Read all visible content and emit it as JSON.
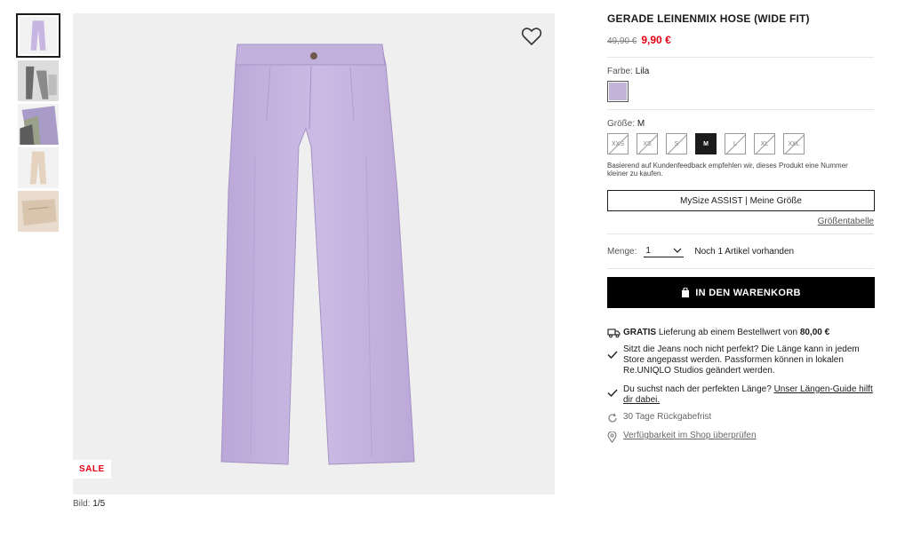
{
  "thumbnails": [
    {
      "name": "thumb-front-lilac",
      "active": true
    },
    {
      "name": "thumb-model-gray",
      "active": false
    },
    {
      "name": "thumb-colors-stack",
      "active": false
    },
    {
      "name": "thumb-beige",
      "active": false
    },
    {
      "name": "thumb-beige-detail",
      "active": false
    }
  ],
  "image": {
    "sale_label": "SALE",
    "caption_prefix": "Bild:",
    "caption_value": "1/5"
  },
  "product": {
    "title": "GERADE LEINENMIX HOSE (WIDE FIT)",
    "old_price": "49,90 €",
    "new_price": "9,90 €",
    "color_label": "Farbe:",
    "color_value": "Lila",
    "size_label": "Größe:",
    "size_value": "M",
    "sizes": [
      {
        "label": "XXS",
        "state": "unavailable"
      },
      {
        "label": "XS",
        "state": "unavailable"
      },
      {
        "label": "S",
        "state": "unavailable"
      },
      {
        "label": "M",
        "state": "selected"
      },
      {
        "label": "L",
        "state": "unavailable"
      },
      {
        "label": "XL",
        "state": "unavailable"
      },
      {
        "label": "XXL",
        "state": "unavailable"
      }
    ],
    "size_note": "Basierend auf Kundenfeedback empfehlen wir, dieses Produkt eine Nummer kleiner zu kaufen.",
    "mysize_button": "MySize ASSIST | Meine Größe",
    "size_table_link": "Größentabelle",
    "qty_label": "Menge:",
    "qty_value": "1",
    "stock_text": "Noch 1 Artikel vorhanden",
    "cart_button": "IN DEN WARENKORB"
  },
  "perks": {
    "shipping_bold": "GRATIS",
    "shipping_text": " Lieferung ab einem Bestellwert von ",
    "shipping_amount": "80,00 €",
    "jeans_text": "Sitzt die Jeans noch nicht perfekt? Die Länge kann in jedem Store angepasst werden. Passformen können in lokalen Re.UNIQLO Studios geändert werden.",
    "length_text": "Du suchst nach der perfekten Länge? ",
    "length_link": "Unser Längen-Guide hilft dir dabei.",
    "return_text": "30 Tage Rückgabefrist",
    "store_link": "Verfügbarkeit im Shop überprüfen"
  },
  "colors": {
    "sale_red": "#e60013",
    "swatch_lilac": "#c4b3d9",
    "pants_lilac": "#c8b6e2"
  }
}
